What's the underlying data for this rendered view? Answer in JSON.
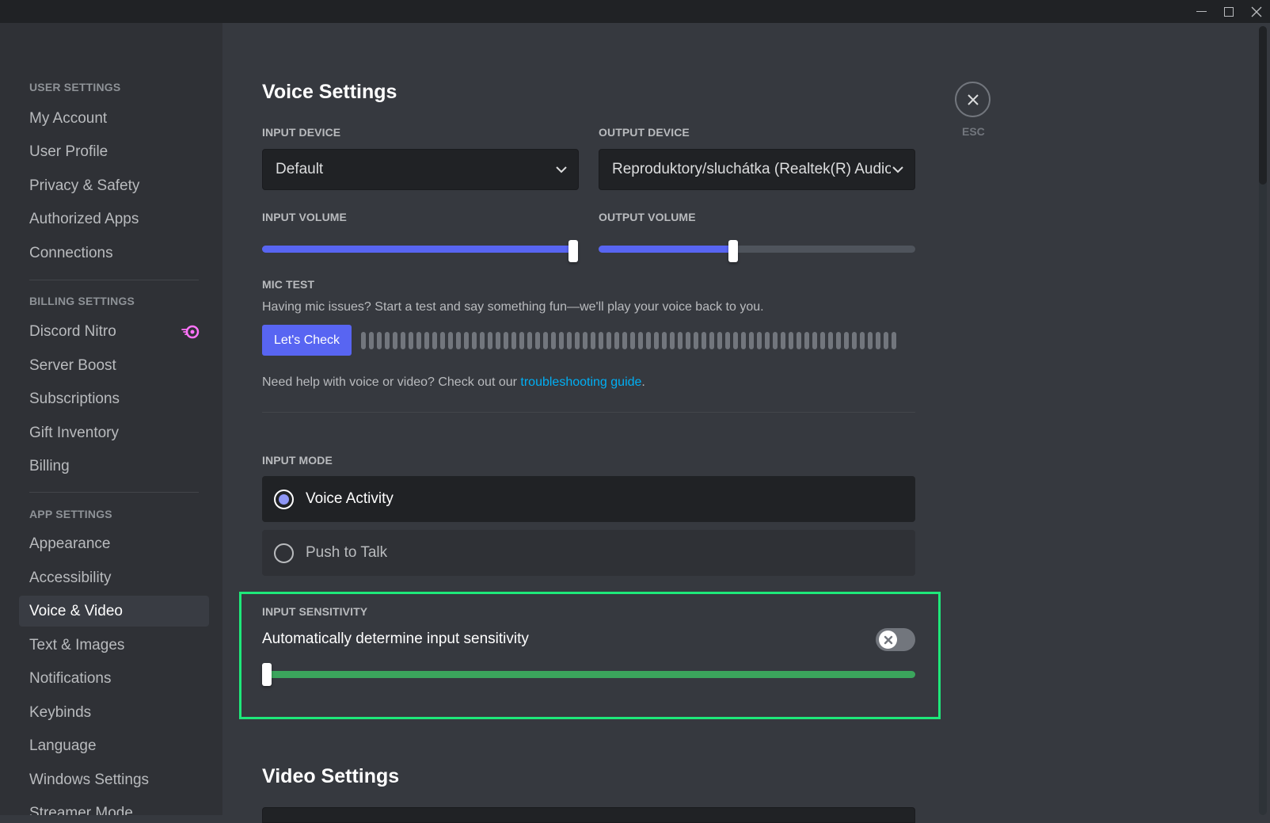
{
  "window": {
    "controls": {
      "minimize": "minimize",
      "maximize": "maximize",
      "close": "close"
    }
  },
  "sidebar": {
    "sections": [
      {
        "header": "USER SETTINGS",
        "items": [
          {
            "label": "My Account"
          },
          {
            "label": "User Profile"
          },
          {
            "label": "Privacy & Safety"
          },
          {
            "label": "Authorized Apps"
          },
          {
            "label": "Connections"
          }
        ]
      },
      {
        "header": "BILLING SETTINGS",
        "items": [
          {
            "label": "Discord Nitro",
            "icon": "nitro-icon"
          },
          {
            "label": "Server Boost"
          },
          {
            "label": "Subscriptions"
          },
          {
            "label": "Gift Inventory"
          },
          {
            "label": "Billing"
          }
        ]
      },
      {
        "header": "APP SETTINGS",
        "items": [
          {
            "label": "Appearance"
          },
          {
            "label": "Accessibility"
          },
          {
            "label": "Voice & Video",
            "selected": true
          },
          {
            "label": "Text & Images"
          },
          {
            "label": "Notifications"
          },
          {
            "label": "Keybinds"
          },
          {
            "label": "Language"
          },
          {
            "label": "Windows Settings"
          },
          {
            "label": "Streamer Mode"
          }
        ]
      }
    ]
  },
  "main": {
    "voice_title": "Voice Settings",
    "input_device": {
      "label": "INPUT DEVICE",
      "value": "Default"
    },
    "output_device": {
      "label": "OUTPUT DEVICE",
      "value": "Reproduktory/sluchátka (Realtek(R) Audio)"
    },
    "input_volume": {
      "label": "INPUT VOLUME",
      "percent": 100
    },
    "output_volume": {
      "label": "OUTPUT VOLUME",
      "percent": 42.5
    },
    "mic_test": {
      "label": "MIC TEST",
      "description": "Having mic issues? Start a test and say something fun—we'll play your voice back to you.",
      "button": "Let's Check",
      "meter_ticks": 68,
      "meter_level": 0
    },
    "help": {
      "prefix": "Need help with voice or video? Check out our ",
      "link": "troubleshooting guide",
      "suffix": "."
    },
    "input_mode": {
      "label": "INPUT MODE",
      "options": [
        {
          "label": "Voice Activity",
          "selected": true
        },
        {
          "label": "Push to Talk",
          "selected": false
        }
      ]
    },
    "input_sensitivity": {
      "label": "INPUT SENSITIVITY",
      "auto_label": "Automatically determine input sensitivity",
      "auto_enabled": false,
      "threshold_percent": 0,
      "highlight_color": "#1ee87a"
    },
    "video_title": "Video Settings"
  },
  "close": {
    "label": "ESC"
  },
  "colors": {
    "accent": "#5865f2",
    "green": "#3ba55c",
    "link": "#00aff4"
  }
}
